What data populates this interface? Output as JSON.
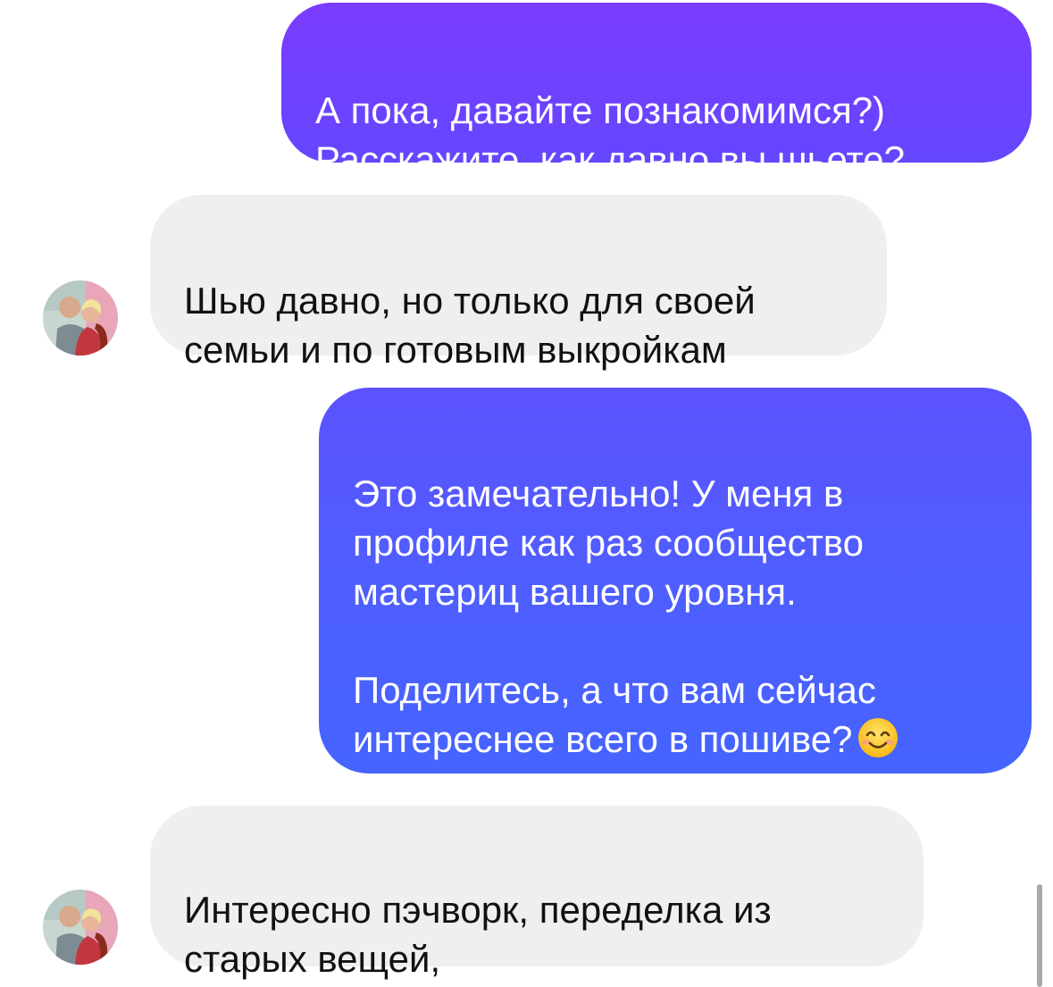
{
  "messages": [
    {
      "direction": "outgoing",
      "text": "А пока, давайте познакомимся?)\nРасскажите, как давно вы шьете?"
    },
    {
      "direction": "incoming",
      "text": "Шью давно, но только для своей\nсемьи и по готовым выкройкам"
    },
    {
      "direction": "outgoing",
      "text": "Это замечательно! У меня в\nпрофиле как раз сообщество\nмастериц вашего уровня.\n\nПоделитесь, а что вам сейчас\nинтереснее всего в пошиве?",
      "emoji": "smiling-face-emoji"
    },
    {
      "direction": "incoming",
      "text": "Интересно пэчворк, переделка из\nстарых вещей,"
    }
  ],
  "colors": {
    "outgoing_gradient_top": "#7a3cff",
    "outgoing_gradient_bottom": "#4564ff",
    "incoming_bubble": "#efefef",
    "incoming_text": "#111111"
  }
}
